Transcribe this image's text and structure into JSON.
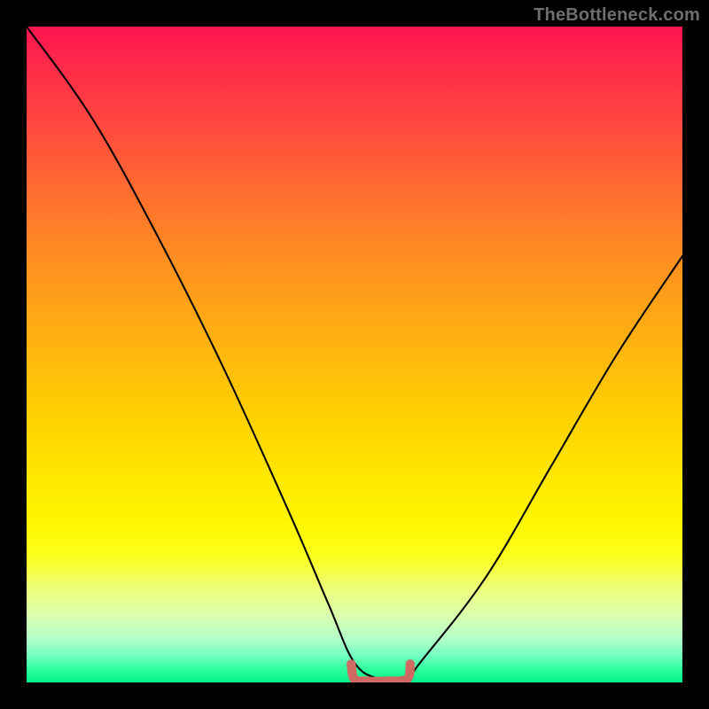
{
  "watermark": "TheBottleneck.com",
  "chart_data": {
    "type": "line",
    "title": "",
    "xlabel": "",
    "ylabel": "",
    "xlim": [
      0,
      100
    ],
    "ylim": [
      0,
      100
    ],
    "series": [
      {
        "name": "bottleneck-curve",
        "color": "#000000",
        "x": [
          0,
          10,
          20,
          30,
          40,
          46,
          50,
          54,
          58,
          60,
          70,
          80,
          90,
          100
        ],
        "y": [
          100,
          86,
          68,
          48,
          26,
          12,
          3,
          0.5,
          0.5,
          3,
          16,
          33,
          50,
          65
        ]
      },
      {
        "name": "optimal-band",
        "color": "#cf6a62",
        "x": [
          49.5,
          50,
          52,
          55,
          58,
          58.5
        ],
        "y": [
          2.8,
          0.5,
          0.2,
          0.2,
          0.5,
          2.8
        ]
      }
    ],
    "annotations": []
  }
}
